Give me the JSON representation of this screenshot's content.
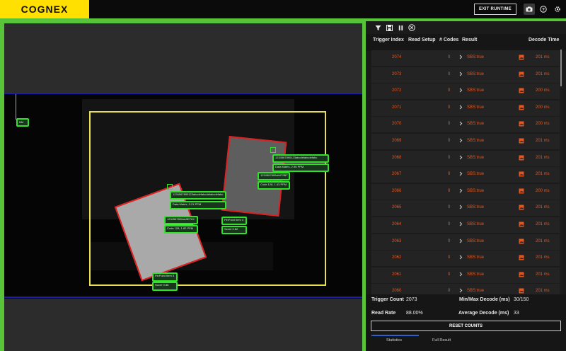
{
  "header": {
    "logo_text": "COGNEX",
    "exit_label": "EXIT RUNTIME",
    "icons": [
      "camera-icon",
      "help-icon",
      "gear-icon"
    ]
  },
  "viewer": {
    "tags": {
      "ul": "NM",
      "b1_code": "1234567890123abcdefabcdefabcdefabc",
      "b1_dm": "Data Matrix, 3.21 PPM",
      "b1_bar": "1234567890ab0EF6X",
      "b1_c128": "Code 128, 1.82 PPM",
      "b1_ppn": "PinPoint Item 5",
      "b1_score": "Score 0.86",
      "b2_code": "1234567890123abcdefabcdefabc",
      "b2_dm": "Data Matrix, 2.96 PPM",
      "b2_bar": "1234567890ab0T9BT",
      "b2_c128": "Code 128, 1.43 PPM",
      "b2_ppn": "PinPoint Item 4",
      "b2_score": "Score 0.82"
    },
    "colors": {
      "roi": "#e8e04a",
      "found": "#e02020",
      "tag": "#33e02a",
      "band": "#1d1da8"
    }
  },
  "panel": {
    "toolbar_icons": [
      "filter-icon",
      "save-icon",
      "pause-icon",
      "clear-icon"
    ],
    "columns": [
      "Trigger Index",
      "Read Setup",
      "# Codes",
      "Result",
      "Decode Time"
    ],
    "rows": [
      {
        "index": "2074",
        "codes": "0",
        "result": "SBS:true",
        "time": "201 ms"
      },
      {
        "index": "2073",
        "codes": "0",
        "result": "SBS:true",
        "time": "201 ms"
      },
      {
        "index": "2072",
        "codes": "0",
        "result": "SBS:true",
        "time": "200 ms"
      },
      {
        "index": "2071",
        "codes": "0",
        "result": "SBS:true",
        "time": "200 ms"
      },
      {
        "index": "2070",
        "codes": "0",
        "result": "SBS:true",
        "time": "200 ms"
      },
      {
        "index": "2069",
        "codes": "0",
        "result": "SBS:true",
        "time": "201 ms"
      },
      {
        "index": "2068",
        "codes": "0",
        "result": "SBS:true",
        "time": "201 ms"
      },
      {
        "index": "2067",
        "codes": "0",
        "result": "SBS:true",
        "time": "201 ms"
      },
      {
        "index": "2066",
        "codes": "0",
        "result": "SBS:true",
        "time": "200 ms"
      },
      {
        "index": "2065",
        "codes": "0",
        "result": "SBS:true",
        "time": "201 ms"
      },
      {
        "index": "2064",
        "codes": "0",
        "result": "SBS:true",
        "time": "201 ms"
      },
      {
        "index": "2063",
        "codes": "0",
        "result": "SBS:true",
        "time": "201 ms"
      },
      {
        "index": "2062",
        "codes": "0",
        "result": "SBS:true",
        "time": "201 ms"
      },
      {
        "index": "2061",
        "codes": "0",
        "result": "SBS:true",
        "time": "201 ms"
      },
      {
        "index": "2060",
        "codes": "0",
        "result": "SBS:true",
        "time": "201 ms"
      }
    ],
    "result_color": "#e8561d",
    "stats": {
      "trigger_count_label": "Trigger Count",
      "trigger_count": "2073",
      "minmax_label": "Min/Max Decode (ms)",
      "minmax": "30/150",
      "read_rate_label": "Read Rate",
      "read_rate": "88.00%",
      "avg_label": "Average Decode (ms)",
      "avg": "33",
      "reset_label": "RESET COUNTS"
    },
    "tabs": [
      {
        "label": "Statistics",
        "active": true
      },
      {
        "label": "Full Result",
        "active": false
      }
    ]
  }
}
